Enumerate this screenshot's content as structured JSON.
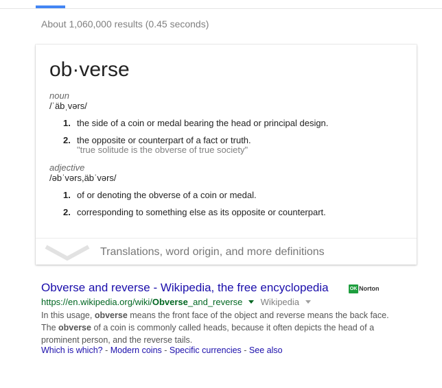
{
  "stats": {
    "text": "About 1,060,000 results (0.45 seconds)"
  },
  "colors": {
    "accent": "#4285f4",
    "link": "#1a0dab",
    "url": "#006621",
    "snippet": "#545454",
    "norton": "#1e9e3e"
  },
  "dictionary": {
    "word": "ob·verse",
    "noun": {
      "pos": "noun",
      "pronunciation": "/ˈäbˌvərs/",
      "definitions": [
        {
          "num": "1.",
          "text": "the side of a coin or medal bearing the head or principal design."
        },
        {
          "num": "2.",
          "text": "the opposite or counterpart of a fact or truth.",
          "example": "\"true solitude is the obverse of true society\""
        }
      ]
    },
    "adjective": {
      "pos": "adjective",
      "pronunciation": "/əbˈvərs,äbˈvərs/",
      "definitions": [
        {
          "num": "1.",
          "text": "of or denoting the obverse of a coin or medal."
        },
        {
          "num": "2.",
          "text": "corresponding to something else as its opposite or counterpart."
        }
      ]
    },
    "more_label": "Translations, word origin, and more definitions",
    "more_icon": "chevron-down-icon"
  },
  "result": {
    "title": "Obverse and reverse - Wikipedia, the free encyclopedia",
    "badge": {
      "check": "OK",
      "label": "Norton"
    },
    "url_prefix": "https://en.wikipedia.org/wiki/",
    "url_bold": "Obverse",
    "url_suffix": "_and_reverse",
    "site": "Wikipedia",
    "snippet": [
      {
        "text": "In this usage, ",
        "bold": false
      },
      {
        "text": "obverse",
        "bold": true
      },
      {
        "text": " means the front face of the object and reverse means the back face. The ",
        "bold": false
      },
      {
        "text": "obverse",
        "bold": true
      },
      {
        "text": " of a coin is commonly called heads, because it often depicts the head of a prominent person, and the reverse tails.",
        "bold": false
      }
    ],
    "sitelinks": [
      "Which is which?",
      "Modern coins",
      "Specific currencies",
      "See also"
    ],
    "sitelink_separator": " - "
  }
}
